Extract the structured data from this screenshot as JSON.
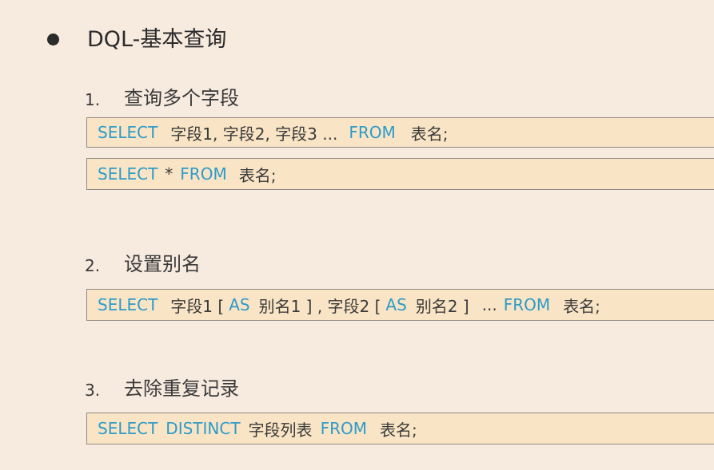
{
  "slide": {
    "title": "DQL-基本查询"
  },
  "sections": [
    {
      "number": "1.",
      "label": "查询多个字段",
      "statements": [
        [
          "SELECT",
          "字段1, 字段2, 字段3 ...",
          "FROM",
          "表名;"
        ],
        [
          "SELECT",
          "*",
          "FROM",
          "表名;"
        ]
      ]
    },
    {
      "number": "2.",
      "label": "设置别名",
      "statements": [
        [
          "SELECT",
          "字段1 [",
          "AS",
          "别名1 ] , 字段2 [",
          "AS",
          "别名2 ]",
          "...",
          "FROM",
          "表名;"
        ]
      ]
    },
    {
      "number": "3.",
      "label": "去除重复记录",
      "statements": [
        [
          "SELECT",
          "DISTINCT",
          "字段列表",
          "FROM",
          "表名;"
        ]
      ]
    }
  ],
  "colors": {
    "keyword": "#2e9bc9",
    "text": "#3a3a3a",
    "background": "#f7eadf",
    "code_box": "#f9e5c5"
  }
}
